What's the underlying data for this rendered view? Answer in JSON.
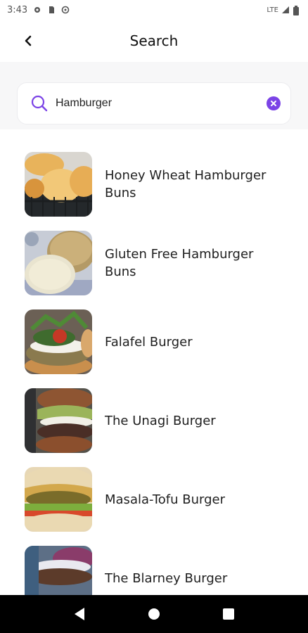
{
  "status_bar": {
    "time": "3:43",
    "network": "LTE"
  },
  "header": {
    "title": "Search"
  },
  "search": {
    "value": "Hamburger",
    "accent": "#7b43e6"
  },
  "results": [
    {
      "title": "Honey Wheat Hamburger Buns"
    },
    {
      "title": "Gluten Free Hamburger Buns"
    },
    {
      "title": "Falafel Burger"
    },
    {
      "title": "The Unagi Burger"
    },
    {
      "title": "Masala-Tofu Burger"
    },
    {
      "title": "The Blarney Burger"
    }
  ],
  "icons": {
    "back": "back-arrow-icon",
    "search": "search-icon",
    "clear": "clear-icon",
    "nav_back": "nav-back-icon",
    "nav_home": "nav-home-icon",
    "nav_recents": "nav-recents-icon"
  }
}
